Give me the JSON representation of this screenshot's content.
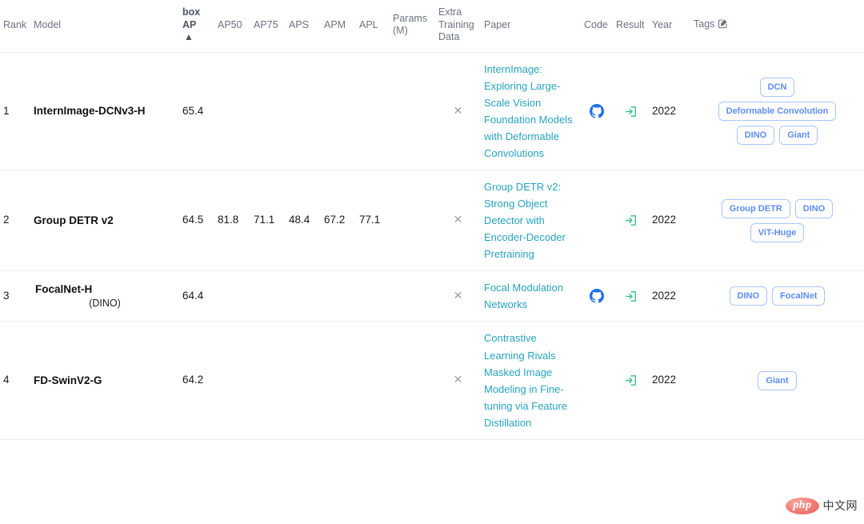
{
  "table": {
    "columns": [
      {
        "key": "rank",
        "label": "Rank",
        "sorted": false
      },
      {
        "key": "model",
        "label": "Model",
        "sorted": false
      },
      {
        "key": "box_ap",
        "label": "box AP",
        "sorted": true,
        "sort_arrow": "▲"
      },
      {
        "key": "ap50",
        "label": "AP50",
        "sorted": false
      },
      {
        "key": "ap75",
        "label": "AP75",
        "sorted": false
      },
      {
        "key": "aps",
        "label": "APS",
        "sorted": false
      },
      {
        "key": "apm",
        "label": "APM",
        "sorted": false
      },
      {
        "key": "apl",
        "label": "APL",
        "sorted": false
      },
      {
        "key": "params",
        "label": "Params (M)",
        "sorted": false
      },
      {
        "key": "extra",
        "label": "Extra Training Data",
        "sorted": false
      },
      {
        "key": "paper",
        "label": "Paper",
        "sorted": false
      },
      {
        "key": "code",
        "label": "Code",
        "sorted": false
      },
      {
        "key": "result",
        "label": "Result",
        "sorted": false
      },
      {
        "key": "year",
        "label": "Year",
        "sorted": false
      },
      {
        "key": "tags",
        "label": "Tags",
        "sorted": false,
        "edit_icon": "edit-square-icon"
      }
    ],
    "rows": [
      {
        "rank": "1",
        "model": "InternImage-DCNv3-H",
        "model_sub": "",
        "box_ap": "65.4",
        "ap50": "",
        "ap75": "",
        "aps": "",
        "apm": "",
        "apl": "",
        "params": "",
        "extra": "✕",
        "paper": "InternImage: Exploring Large-Scale Vision Foundation Models with Deformable Convolutions",
        "code": "github-icon",
        "result": "enter-box-icon",
        "year": "2022",
        "tags": [
          "DCN",
          "Deformable Convolution",
          "DINO",
          "Giant"
        ]
      },
      {
        "rank": "2",
        "model": "Group DETR v2",
        "model_sub": "",
        "box_ap": "64.5",
        "ap50": "81.8",
        "ap75": "71.1",
        "aps": "48.4",
        "apm": "67.2",
        "apl": "77.1",
        "params": "",
        "extra": "✕",
        "paper": "Group DETR v2: Strong Object Detector with Encoder-Decoder Pretraining",
        "code": "",
        "result": "enter-box-icon",
        "year": "2022",
        "tags": [
          "Group DETR",
          "DINO",
          "ViT-Huge"
        ]
      },
      {
        "rank": "3",
        "model": "FocalNet-H",
        "model_sub": "(DINO)",
        "box_ap": "64.4",
        "ap50": "",
        "ap75": "",
        "aps": "",
        "apm": "",
        "apl": "",
        "params": "",
        "extra": "✕",
        "paper": "Focal Modulation Networks",
        "code": "github-icon",
        "result": "enter-box-icon",
        "year": "2022",
        "tags": [
          "DINO",
          "FocalNet"
        ]
      },
      {
        "rank": "4",
        "model": "FD-SwinV2-G",
        "model_sub": "",
        "box_ap": "64.2",
        "ap50": "",
        "ap75": "",
        "aps": "",
        "apm": "",
        "apl": "",
        "params": "",
        "extra": "✕",
        "paper": "Contrastive Learning Rivals Masked Image Modeling in Fine-tuning via Feature Distillation",
        "code": "",
        "result": "enter-box-icon",
        "year": "2022",
        "tags": [
          "Giant"
        ]
      }
    ]
  },
  "watermark": {
    "logo_text": "php",
    "site_text": "中文网"
  },
  "colors": {
    "paper_link": "#27a3bf",
    "tag_text": "#5b8def",
    "tag_border": "#a9c5f5",
    "github_icon": "#1f6feb",
    "result_icon": "#3fc08d",
    "header_text": "#6b7280",
    "row_border": "#eceef0",
    "watermark_logo_bg": "#ee7a72"
  }
}
